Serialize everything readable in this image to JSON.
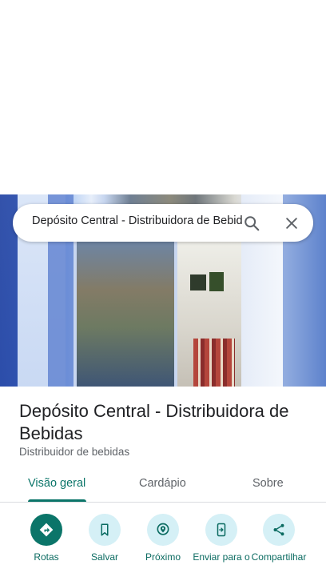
{
  "search": {
    "query": "Depósito Central - Distribuidora de Bebidas"
  },
  "place": {
    "name": "Depósito Central - Distribuidora de Bebidas",
    "category": "Distribuidor de bebidas"
  },
  "tabs": [
    {
      "label": "Visão geral",
      "active": true
    },
    {
      "label": "Cardápio",
      "active": false
    },
    {
      "label": "Sobre",
      "active": false
    }
  ],
  "actions": [
    {
      "label": "Rotas",
      "icon": "directions-icon"
    },
    {
      "label": "Salvar",
      "icon": "bookmark-icon"
    },
    {
      "label": "Próximo",
      "icon": "nearby-icon"
    },
    {
      "label": "Enviar para o",
      "icon": "send-to-phone-icon"
    },
    {
      "label": "Compartilhar",
      "icon": "share-icon"
    }
  ],
  "colors": {
    "accent": "#0b7569",
    "action_bg": "#d5f0f6",
    "text_primary": "#202124",
    "text_secondary": "#5f6368"
  }
}
